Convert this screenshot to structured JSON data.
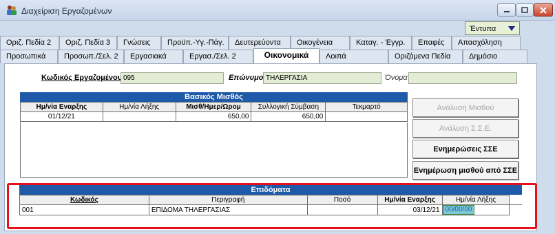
{
  "window": {
    "title": "Διαχείριση Εργαζομένων"
  },
  "print_dropdown": {
    "label": "Έντυπα"
  },
  "tabs_row1": [
    {
      "label": "Οριζ. Πεδία 2"
    },
    {
      "label": "Οριζ. Πεδία 3"
    },
    {
      "label": "Γνώσεις"
    },
    {
      "label": "Προϋπ.-Υγ.-Πάγ."
    },
    {
      "label": "Δευτερεύοντα"
    },
    {
      "label": "Οικογένεια"
    },
    {
      "label": "Καταγ. - Έγγρ."
    },
    {
      "label": "Επαφές"
    },
    {
      "label": "Απασχόληση"
    }
  ],
  "tabs_row2": [
    {
      "label": "Προσωπικά"
    },
    {
      "label": "Προσωπ./Σελ. 2"
    },
    {
      "label": "Εργασιακά"
    },
    {
      "label": "Εργασ./Σελ. 2"
    },
    {
      "label": "Οικονομικά"
    },
    {
      "label": "Λοιπά"
    },
    {
      "label": "Οριζόμενα Πεδία"
    },
    {
      "label": "Δημόσιο"
    }
  ],
  "employee": {
    "code_label": "Κωδικός Εργαζομένου",
    "code_value": "095",
    "surname_label": "Επώνυμο",
    "surname_value": "ΤΗΛΕΡΓΑΣΙΑ",
    "name_label": "Όνομα",
    "name_value": ""
  },
  "basic_salary": {
    "title": "Βασικός Μισθός",
    "headers": [
      "Ημ/νία Εναρξης",
      "Ημ/νία Λήξης",
      "Μισθ/Ημερ/Ωρομ",
      "Συλλογική Σύμβαση",
      "Τεκμαρτό"
    ],
    "rows": [
      [
        "01/12/21",
        "",
        "650,00",
        "650,00",
        ""
      ]
    ]
  },
  "side_buttons": {
    "salary_analysis": "Ανάλυση Μισθού",
    "sse_analysis": "Ανάλυση Σ.Σ.Ε.",
    "sse_updates": "Ενημερώσεις ΣΣΕ",
    "salary_update_from_sse": "Ενημέρωση μισθού από ΣΣΕ"
  },
  "allowances": {
    "title": "Επιδόματα",
    "headers": [
      "Κωδικός",
      "Περιγραφή",
      "Ποσό",
      "Ημ/νία Εναρξης",
      "Ημ/νία Λήξης"
    ],
    "rows": [
      [
        "001",
        "ΕΠΙΔΟΜΑ ΤΗΛΕΡΓΑΣΙΑΣ",
        "",
        "03/12/21",
        "00/00/00"
      ]
    ]
  },
  "colors": {
    "section_header": "#1e5aa8",
    "field_bg": "#e4ecd6",
    "highlight": "#e5101a",
    "selected_cell": "#7fc8d8"
  }
}
